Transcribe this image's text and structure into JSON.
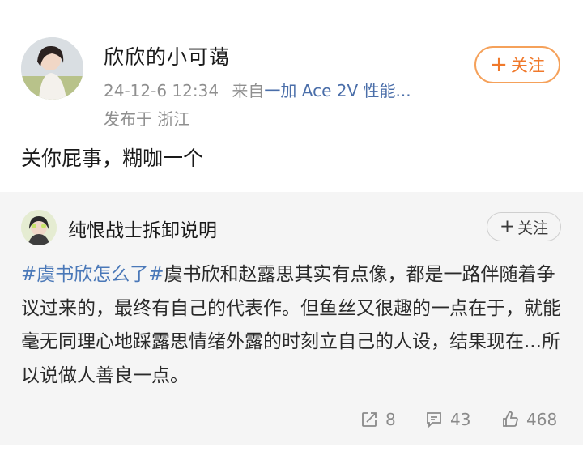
{
  "post": {
    "author": "欣欣的小可蔼",
    "time": "24-12-6 12:34",
    "from_prefix": "来自",
    "device": "一加 Ace 2V 性能...",
    "location": "发布于 浙江",
    "follow_label": "关注",
    "text": "关你屁事，糊咖一个"
  },
  "repost": {
    "author": "纯恨战士拆卸说明",
    "follow_label": "关注",
    "hashtag": "#虞书欣怎么了#",
    "text": "虞书欣和赵露思其实有点像，都是一路伴随着争议过来的，最终有自己的代表作。但鱼丝又很趣的一点在于，就能毫无同理心地踩露思情绪外露的时刻立自己的人设，结果现在...所以说做人善良一点。",
    "shares": "8",
    "comments": "43",
    "likes": "468"
  },
  "colors": {
    "accent_orange": "#f0792b",
    "link_blue": "#4a78b8",
    "meta_gray": "#8f8f8f",
    "repost_bg": "#f5f5f5"
  },
  "icons": {
    "share": "share-icon",
    "comment": "comment-icon",
    "like": "thumbs-up-icon"
  }
}
